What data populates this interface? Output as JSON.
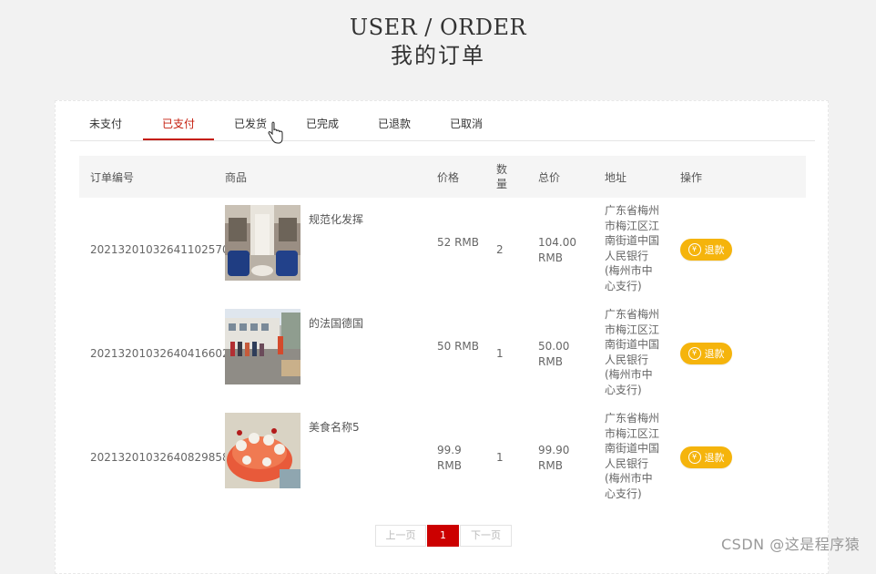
{
  "header": {
    "title_en": "USER / ORDER",
    "title_cn": "我的订单"
  },
  "tabs": [
    {
      "label": "未支付",
      "active": false
    },
    {
      "label": "已支付",
      "active": true
    },
    {
      "label": "已发货",
      "active": false
    },
    {
      "label": "已完成",
      "active": false
    },
    {
      "label": "已退款",
      "active": false
    },
    {
      "label": "已取消",
      "active": false
    }
  ],
  "table": {
    "headers": {
      "order_no": "订单编号",
      "product": "商品",
      "price": "价格",
      "quantity": "数量",
      "total": "总价",
      "address": "地址",
      "action": "操作"
    },
    "rows": [
      {
        "order_no": "20213201032641102570",
        "product": "规范化发挥",
        "price": "52 RMB",
        "quantity": "2",
        "total": "104.00 RMB",
        "address": "广东省梅州市梅江区江南街道中国人民银行(梅州市中心支行)",
        "action": "退款"
      },
      {
        "order_no": "20213201032640416602",
        "product": "的法国德国",
        "price": "50 RMB",
        "quantity": "1",
        "total": "50.00 RMB",
        "address": "广东省梅州市梅江区江南街道中国人民银行(梅州市中心支行)",
        "action": "退款"
      },
      {
        "order_no": "20213201032640829858",
        "product": "美食名称5",
        "price": "99.9 RMB",
        "quantity": "1",
        "total": "99.90 RMB",
        "address": "广东省梅州市梅江区江南街道中国人民银行(梅州市中心支行)",
        "action": "退款"
      }
    ]
  },
  "pagination": {
    "prev": "上一页",
    "current": "1",
    "next": "下一页"
  },
  "watermark": "CSDN @这是程序猿",
  "colors": {
    "accent": "#c51d0c",
    "refund_button": "#f5b40c",
    "page_current": "#cc0000"
  },
  "icons": {
    "cursor": "hand-pointer-icon",
    "refund": "yen-circle-icon"
  }
}
